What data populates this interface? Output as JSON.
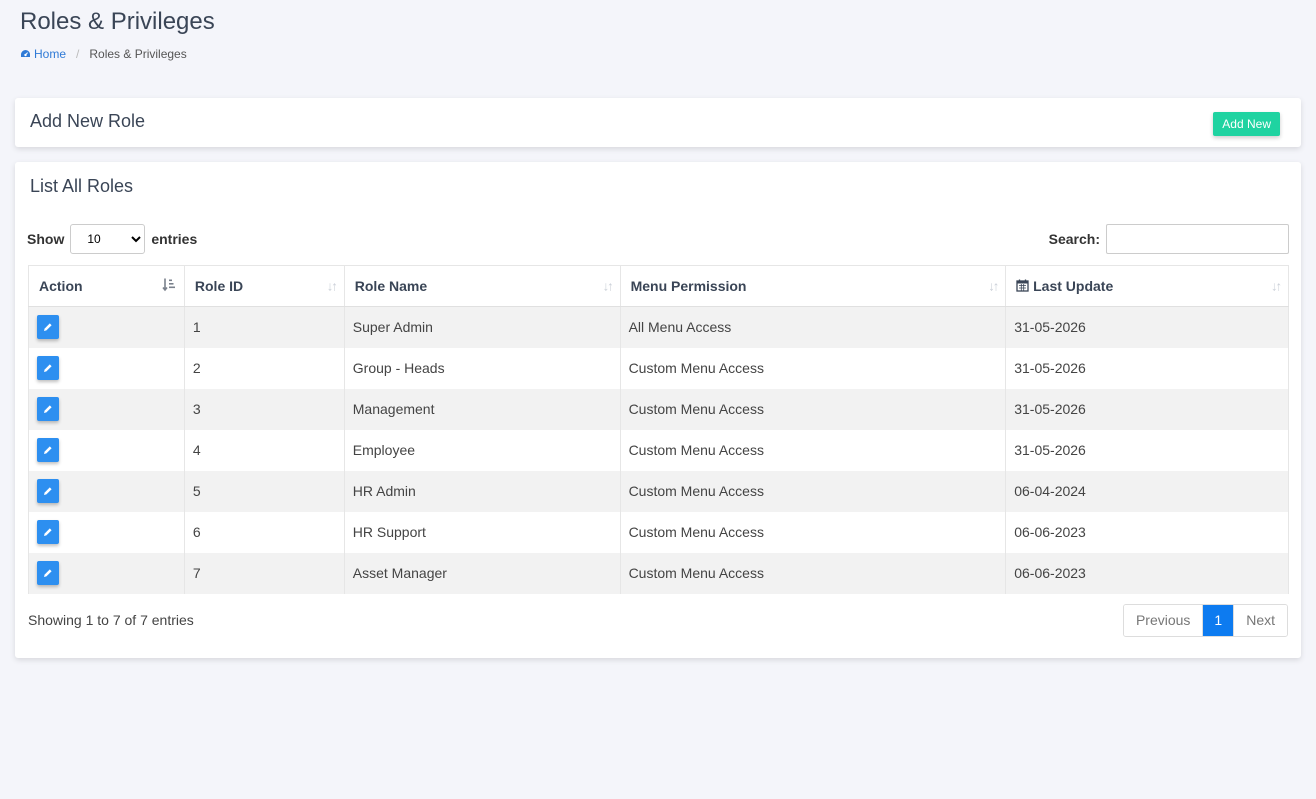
{
  "page": {
    "title": "Roles & Privileges",
    "breadcrumb": {
      "home": "Home",
      "current": "Roles & Privileges"
    }
  },
  "add_card": {
    "title": "Add New Role",
    "button": "Add New"
  },
  "list_card": {
    "title": "List All Roles",
    "show_label": "Show",
    "entries_label": "entries",
    "page_length": "10",
    "search_label": "Search:",
    "search_value": ""
  },
  "table": {
    "headers": [
      "Action",
      "Role ID",
      "Role Name",
      "Menu Permission",
      "Last Update"
    ],
    "rows": [
      {
        "id": "1",
        "name": "Super Admin",
        "permission": "All Menu Access",
        "updated": "31-05-2026"
      },
      {
        "id": "2",
        "name": "Group - Heads",
        "permission": "Custom Menu Access",
        "updated": "31-05-2026"
      },
      {
        "id": "3",
        "name": "Management",
        "permission": "Custom Menu Access",
        "updated": "31-05-2026"
      },
      {
        "id": "4",
        "name": "Employee",
        "permission": "Custom Menu Access",
        "updated": "31-05-2026"
      },
      {
        "id": "5",
        "name": "HR Admin",
        "permission": "Custom Menu Access",
        "updated": "06-04-2024"
      },
      {
        "id": "6",
        "name": "HR Support",
        "permission": "Custom Menu Access",
        "updated": "06-06-2023"
      },
      {
        "id": "7",
        "name": "Asset Manager",
        "permission": "Custom Menu Access",
        "updated": "06-06-2023"
      }
    ]
  },
  "footer": {
    "info": "Showing 1 to 7 of 7 entries",
    "previous": "Previous",
    "current_page": "1",
    "next": "Next"
  },
  "colors": {
    "accent_green": "#1fd3a1",
    "edit_blue": "#2d8ff0",
    "page_active": "#0d7bf0",
    "link": "#2f7ad6"
  },
  "icons": {
    "home": "dashboard-icon",
    "edit": "pencil-icon",
    "calendar": "calendar-icon",
    "sort": "sort-arrows-icon"
  }
}
